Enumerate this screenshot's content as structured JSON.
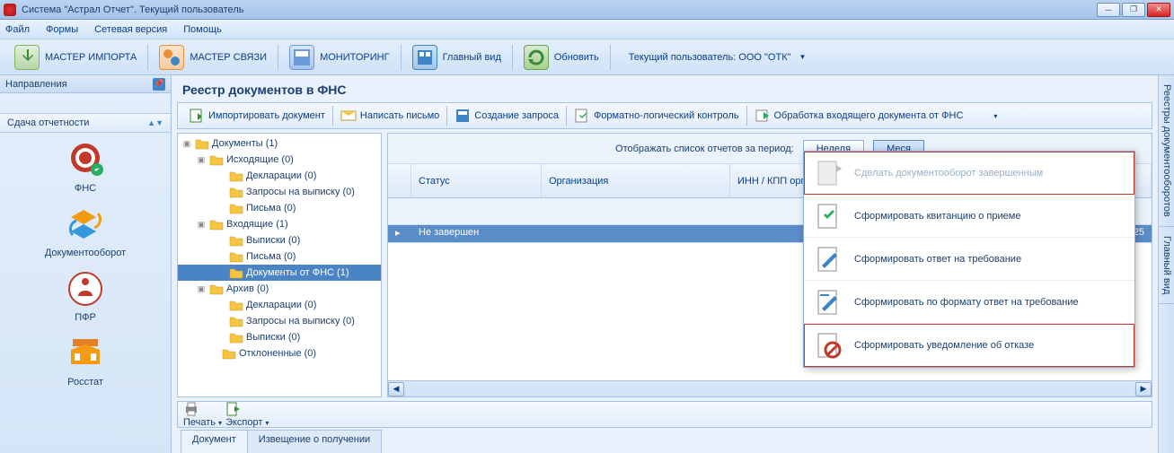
{
  "title": "Система \"Астрал Отчет\". Текущий пользователь",
  "menu": {
    "file": "Файл",
    "forms": "Формы",
    "net": "Сетевая версия",
    "help": "Помощь"
  },
  "maintool": {
    "import": "МАСТЕР ИМПОРТА",
    "link": "МАСТЕР СВЯЗИ",
    "mon": "МОНИТОРИНГ",
    "home": "Главный вид",
    "refresh": "Обновить",
    "user": "Текущий пользователь: ООО \"ОТК\""
  },
  "left": {
    "head": "Направления",
    "section": "Сдача отчетности",
    "items": [
      "ФНС",
      "Документооборот",
      "ПФР",
      "Росстат"
    ]
  },
  "center": {
    "title": "Реестр документов в ФНС",
    "subtool": {
      "import": "Импортировать документ",
      "letter": "Написать письмо",
      "req": "Создание запроса",
      "check": "Форматно-логический контроль",
      "inc": "Обработка входящего документа от ФНС"
    },
    "tree": [
      "Документы (1)",
      "Исходящие (0)",
      "Декларации (0)",
      "Запросы на выписку (0)",
      "Письма (0)",
      "Входящие (1)",
      "Выписки (0)",
      "Письма (0)",
      "Документы от ФНС (1)",
      "Архив (0)",
      "Декларации (0)",
      "Запросы на выписку (0)",
      "Выписки (0)",
      "Отклоненные (0)"
    ],
    "filter": {
      "label": "Отображать список отчетов за период:",
      "week": "Неделя",
      "month": "Меся"
    },
    "cols": {
      "status": "Статус",
      "org": "Организация",
      "inn": "ИНН / КПП орган"
    },
    "row": {
      "status": "Не завершен",
      "org": "",
      "inn": "/ 4025"
    },
    "print": "Печать",
    "export": "Экспорт",
    "tabs": {
      "doc": "Документ",
      "note": "Извещение о получении"
    }
  },
  "dd": {
    "complete": "Сделать документооборот завершенным",
    "receipt": "Сформировать квитанцию о приеме",
    "answer": "Сформировать ответ на требование",
    "fmtanswer": "Сформировать по формату ответ на требование",
    "refuse": "Сформировать уведомление об отказе"
  },
  "right": {
    "reestr": "Реестры документооборотов",
    "main": "Главный вид"
  }
}
